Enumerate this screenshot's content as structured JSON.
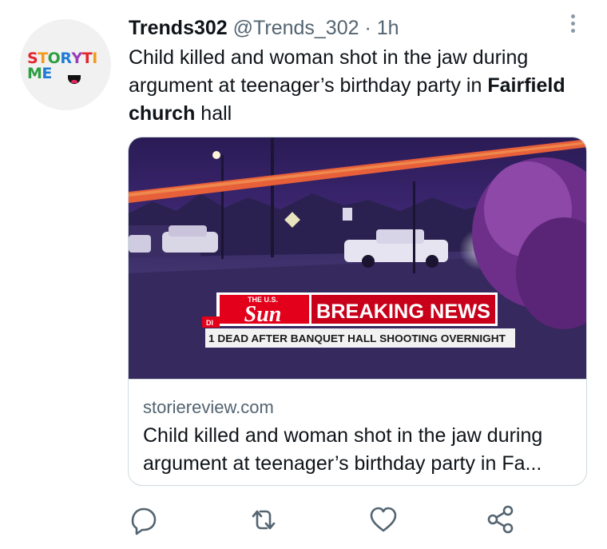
{
  "author": {
    "display_name": "Trends302",
    "handle": "@Trends_302",
    "separator": " · ",
    "time": "1h",
    "avatar_text": "STORYTIME"
  },
  "tweet": {
    "text_part1": "Child killed and woman shot in the jaw during argument at teenager’s birthday party in ",
    "text_bold": "Fairfield church",
    "text_part2": " hall"
  },
  "card": {
    "image": {
      "banner_brand_small": "THE U.S.",
      "banner_brand": "Sun",
      "banner_headline": "BREAKING NEWS",
      "banner_ticker": "1 DEAD AFTER BANQUET HALL SHOOTING OVERNIGHT",
      "banner_tag": "DI"
    },
    "domain": "storiereview.com",
    "title": "Child killed and woman shot in the jaw during argument at teenager’s birthday party in Fa..."
  },
  "actions": [
    "reply-icon",
    "retweet-icon",
    "like-icon",
    "share-icon"
  ],
  "colors": {
    "text_primary": "#0f1419",
    "text_secondary": "#536471",
    "border": "#cfd9de",
    "icon": "#536471",
    "sun_red": "#e2001a"
  }
}
